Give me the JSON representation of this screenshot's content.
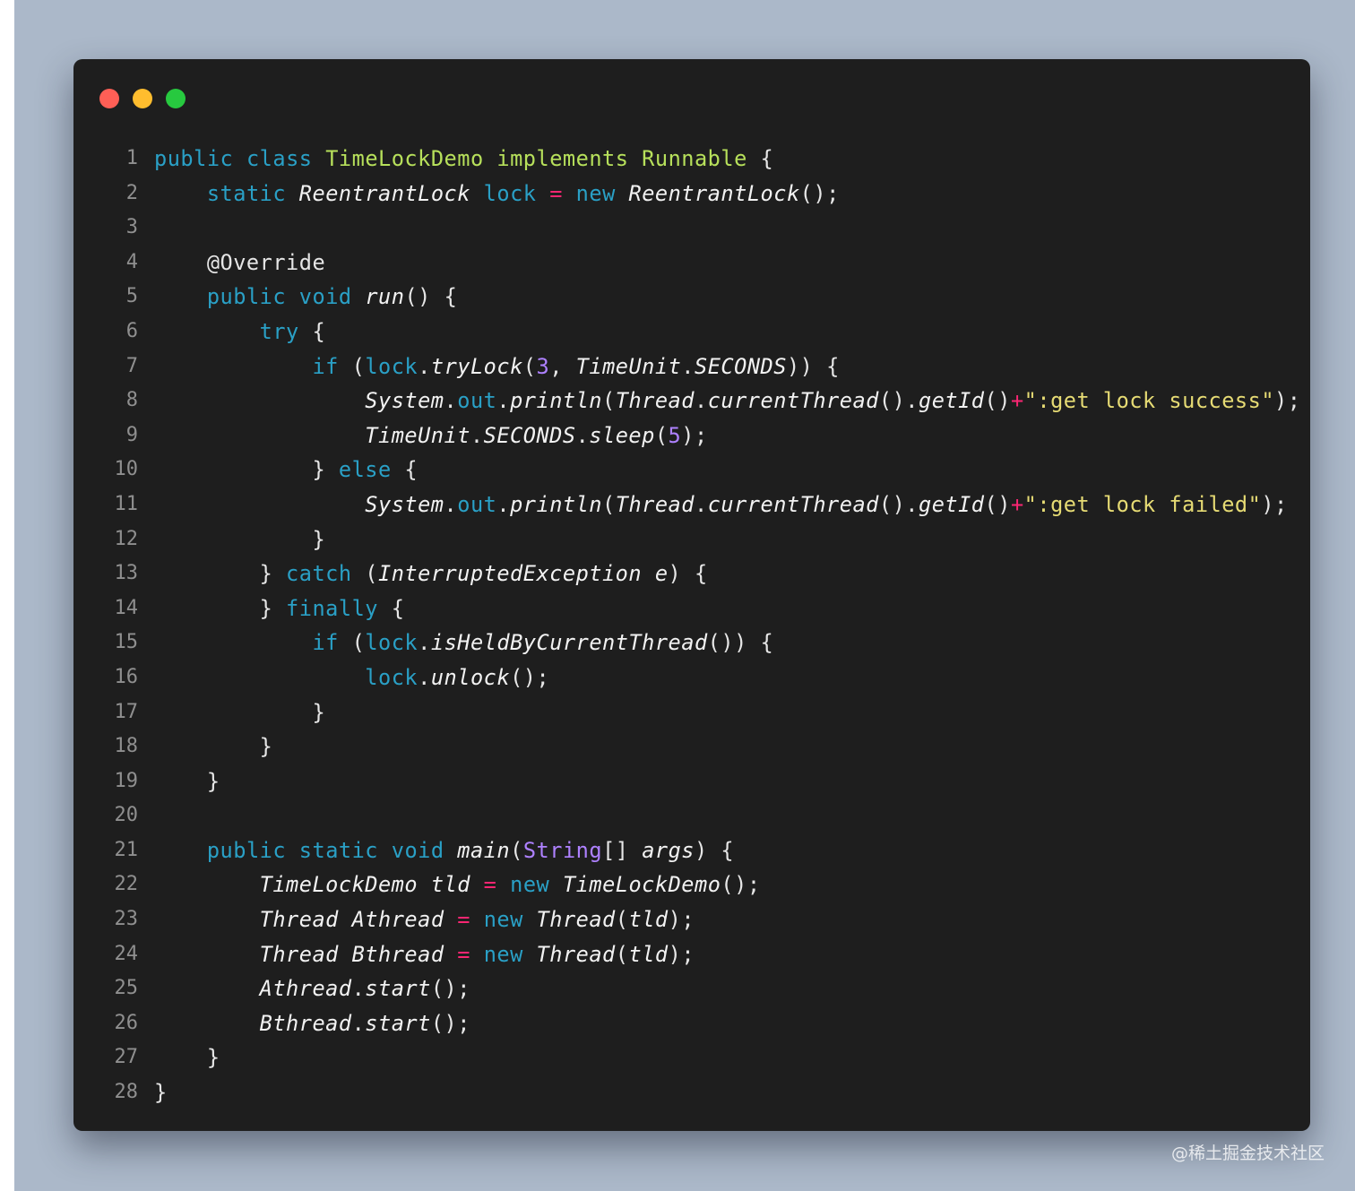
{
  "window": {
    "traffic_lights": [
      {
        "name": "close",
        "color": "#ff5f56"
      },
      {
        "name": "minimize",
        "color": "#ffbd2e"
      },
      {
        "name": "maximize",
        "color": "#27c93f"
      }
    ]
  },
  "code": {
    "language": "java",
    "lines": [
      [
        [
          "kw",
          "public"
        ],
        [
          "pl",
          " "
        ],
        [
          "kw",
          "class"
        ],
        [
          "pl",
          " "
        ],
        [
          "typ",
          "TimeLockDemo"
        ],
        [
          "pl",
          " "
        ],
        [
          "typ",
          "implements"
        ],
        [
          "pl",
          " "
        ],
        [
          "typ",
          "Runnable"
        ],
        [
          "pl",
          " {"
        ]
      ],
      [
        [
          "pl",
          "    "
        ],
        [
          "kw",
          "static"
        ],
        [
          "pl",
          " "
        ],
        [
          "it",
          "ReentrantLock"
        ],
        [
          "pl",
          " "
        ],
        [
          "fld",
          "lock"
        ],
        [
          "pl",
          " "
        ],
        [
          "op",
          "="
        ],
        [
          "pl",
          " "
        ],
        [
          "kw",
          "new"
        ],
        [
          "pl",
          " "
        ],
        [
          "it",
          "ReentrantLock"
        ],
        [
          "pl",
          "();"
        ]
      ],
      [],
      [
        [
          "pl",
          "    @Override"
        ]
      ],
      [
        [
          "pl",
          "    "
        ],
        [
          "kw",
          "public"
        ],
        [
          "pl",
          " "
        ],
        [
          "kw",
          "void"
        ],
        [
          "pl",
          " "
        ],
        [
          "it",
          "run"
        ],
        [
          "pl",
          "() {"
        ]
      ],
      [
        [
          "pl",
          "        "
        ],
        [
          "kw",
          "try"
        ],
        [
          "pl",
          " {"
        ]
      ],
      [
        [
          "pl",
          "            "
        ],
        [
          "kw",
          "if"
        ],
        [
          "pl",
          " ("
        ],
        [
          "fld",
          "lock"
        ],
        [
          "pl",
          "."
        ],
        [
          "it",
          "tryLock"
        ],
        [
          "pl",
          "("
        ],
        [
          "num",
          "3"
        ],
        [
          "pl",
          ", "
        ],
        [
          "it",
          "TimeUnit"
        ],
        [
          "pl",
          "."
        ],
        [
          "it",
          "SECONDS"
        ],
        [
          "pl",
          ")) {"
        ]
      ],
      [
        [
          "pl",
          "                "
        ],
        [
          "it",
          "System"
        ],
        [
          "pl",
          "."
        ],
        [
          "fld",
          "out"
        ],
        [
          "pl",
          "."
        ],
        [
          "it",
          "println"
        ],
        [
          "pl",
          "("
        ],
        [
          "it",
          "Thread"
        ],
        [
          "pl",
          "."
        ],
        [
          "it",
          "currentThread"
        ],
        [
          "pl",
          "()."
        ],
        [
          "it",
          "getId"
        ],
        [
          "pl",
          "()"
        ],
        [
          "op",
          "+"
        ],
        [
          "str",
          "\":get lock success\""
        ],
        [
          "pl",
          ");"
        ]
      ],
      [
        [
          "pl",
          "                "
        ],
        [
          "it",
          "TimeUnit"
        ],
        [
          "pl",
          "."
        ],
        [
          "it",
          "SECONDS"
        ],
        [
          "pl",
          "."
        ],
        [
          "it",
          "sleep"
        ],
        [
          "pl",
          "("
        ],
        [
          "num",
          "5"
        ],
        [
          "pl",
          ");"
        ]
      ],
      [
        [
          "pl",
          "            } "
        ],
        [
          "kw",
          "else"
        ],
        [
          "pl",
          " {"
        ]
      ],
      [
        [
          "pl",
          "                "
        ],
        [
          "it",
          "System"
        ],
        [
          "pl",
          "."
        ],
        [
          "fld",
          "out"
        ],
        [
          "pl",
          "."
        ],
        [
          "it",
          "println"
        ],
        [
          "pl",
          "("
        ],
        [
          "it",
          "Thread"
        ],
        [
          "pl",
          "."
        ],
        [
          "it",
          "currentThread"
        ],
        [
          "pl",
          "()."
        ],
        [
          "it",
          "getId"
        ],
        [
          "pl",
          "()"
        ],
        [
          "op",
          "+"
        ],
        [
          "str",
          "\":get lock failed\""
        ],
        [
          "pl",
          ");"
        ]
      ],
      [
        [
          "pl",
          "            }"
        ]
      ],
      [
        [
          "pl",
          "        } "
        ],
        [
          "kw",
          "catch"
        ],
        [
          "pl",
          " ("
        ],
        [
          "it",
          "InterruptedException"
        ],
        [
          "pl",
          " "
        ],
        [
          "it",
          "e"
        ],
        [
          "pl",
          ") {"
        ]
      ],
      [
        [
          "pl",
          "        } "
        ],
        [
          "kw",
          "finally"
        ],
        [
          "pl",
          " {"
        ]
      ],
      [
        [
          "pl",
          "            "
        ],
        [
          "kw",
          "if"
        ],
        [
          "pl",
          " ("
        ],
        [
          "fld",
          "lock"
        ],
        [
          "pl",
          "."
        ],
        [
          "it",
          "isHeldByCurrentThread"
        ],
        [
          "pl",
          "()) {"
        ]
      ],
      [
        [
          "pl",
          "                "
        ],
        [
          "fld",
          "lock"
        ],
        [
          "pl",
          "."
        ],
        [
          "it",
          "unlock"
        ],
        [
          "pl",
          "();"
        ]
      ],
      [
        [
          "pl",
          "            }"
        ]
      ],
      [
        [
          "pl",
          "        }"
        ]
      ],
      [
        [
          "pl",
          "    }"
        ]
      ],
      [],
      [
        [
          "pl",
          "    "
        ],
        [
          "kw",
          "public"
        ],
        [
          "pl",
          " "
        ],
        [
          "kw",
          "static"
        ],
        [
          "pl",
          " "
        ],
        [
          "kw",
          "void"
        ],
        [
          "pl",
          " "
        ],
        [
          "it",
          "main"
        ],
        [
          "pl",
          "("
        ],
        [
          "num",
          "String"
        ],
        [
          "pl",
          "[] "
        ],
        [
          "it",
          "args"
        ],
        [
          "pl",
          ") {"
        ]
      ],
      [
        [
          "pl",
          "        "
        ],
        [
          "it",
          "TimeLockDemo"
        ],
        [
          "pl",
          " "
        ],
        [
          "it",
          "tld"
        ],
        [
          "pl",
          " "
        ],
        [
          "op",
          "="
        ],
        [
          "pl",
          " "
        ],
        [
          "kw",
          "new"
        ],
        [
          "pl",
          " "
        ],
        [
          "it",
          "TimeLockDemo"
        ],
        [
          "pl",
          "();"
        ]
      ],
      [
        [
          "pl",
          "        "
        ],
        [
          "it",
          "Thread"
        ],
        [
          "pl",
          " "
        ],
        [
          "it",
          "Athread"
        ],
        [
          "pl",
          " "
        ],
        [
          "op",
          "="
        ],
        [
          "pl",
          " "
        ],
        [
          "kw",
          "new"
        ],
        [
          "pl",
          " "
        ],
        [
          "it",
          "Thread"
        ],
        [
          "pl",
          "("
        ],
        [
          "it",
          "tld"
        ],
        [
          "pl",
          ");"
        ]
      ],
      [
        [
          "pl",
          "        "
        ],
        [
          "it",
          "Thread"
        ],
        [
          "pl",
          " "
        ],
        [
          "it",
          "Bthread"
        ],
        [
          "pl",
          " "
        ],
        [
          "op",
          "="
        ],
        [
          "pl",
          " "
        ],
        [
          "kw",
          "new"
        ],
        [
          "pl",
          " "
        ],
        [
          "it",
          "Thread"
        ],
        [
          "pl",
          "("
        ],
        [
          "it",
          "tld"
        ],
        [
          "pl",
          ");"
        ]
      ],
      [
        [
          "pl",
          "        "
        ],
        [
          "it",
          "Athread"
        ],
        [
          "pl",
          "."
        ],
        [
          "it",
          "start"
        ],
        [
          "pl",
          "();"
        ]
      ],
      [
        [
          "pl",
          "        "
        ],
        [
          "it",
          "Bthread"
        ],
        [
          "pl",
          "."
        ],
        [
          "it",
          "start"
        ],
        [
          "pl",
          "();"
        ]
      ],
      [
        [
          "pl",
          "    }"
        ]
      ],
      [
        [
          "pl",
          "}"
        ]
      ]
    ]
  },
  "watermark": "@稀土掘金技术社区"
}
